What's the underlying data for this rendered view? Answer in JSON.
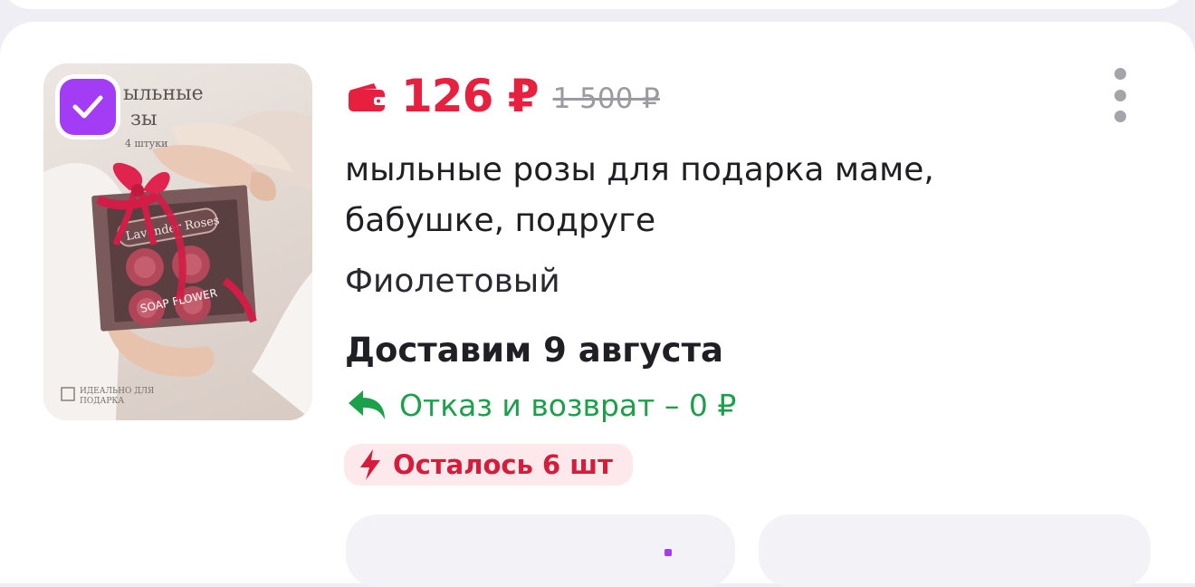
{
  "product": {
    "price": "126 ₽",
    "old_price": "1 500 ₽",
    "title": "мыльные розы для подарка маме, бабушке, подруге",
    "variant": "Фиолетовый",
    "delivery": "Доставим 9 августа",
    "return_policy": "Отказ и возврат – 0 ₽",
    "stock": "Осталось 6 шт",
    "selected": true,
    "image": {
      "heading_line1": "ыльные",
      "heading_line2": "зы",
      "subheading": "4 штуки",
      "box_label": "Lavender Roses",
      "soap_label": "SOAP FLOWER",
      "footer_line1": "ИДЕАЛЬНО ДЛЯ",
      "footer_line2": "ПОДАРКА"
    }
  },
  "icons": {
    "wallet": "wallet-icon",
    "menu": "more-vertical-icon",
    "return": "return-arrow-icon",
    "stock": "lightning-icon",
    "checkbox": "checkmark-icon"
  },
  "colors": {
    "price": "#e8203f",
    "return": "#1ca04a",
    "stock": "#d71c3b",
    "stock_bg": "#fde8ec",
    "checkbox": "#a23cf5"
  }
}
